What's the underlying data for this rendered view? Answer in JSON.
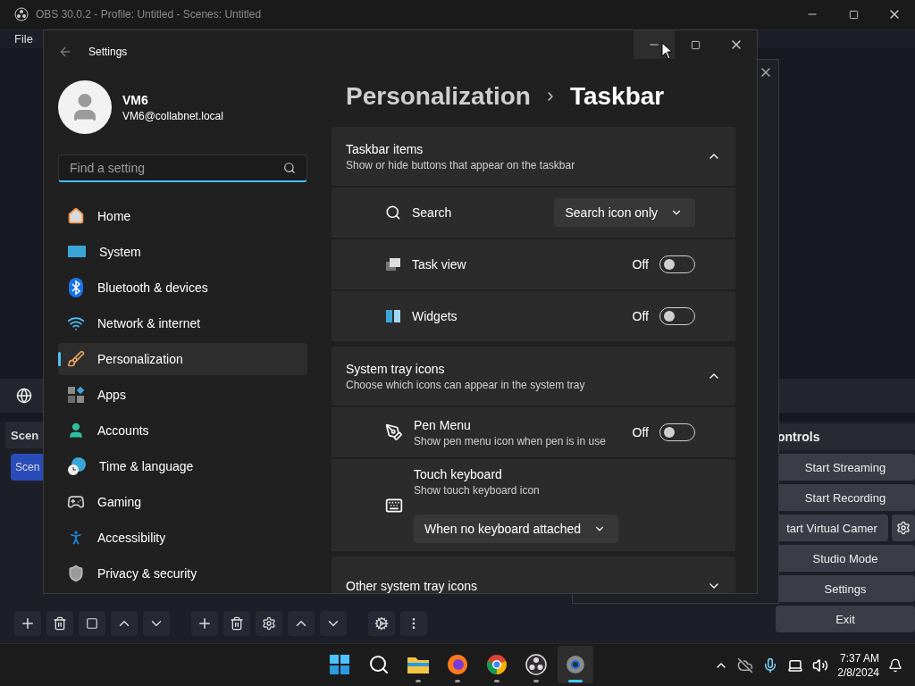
{
  "obs": {
    "title": "OBS 30.0.2 - Profile: Untitled - Scenes: Untitled",
    "menu": [
      "File"
    ],
    "scenes_dock": {
      "title": "Scen",
      "items": [
        {
          "label": "Scen",
          "selected": true
        }
      ]
    },
    "controls_dock": {
      "title": "ontrols",
      "buttons": [
        {
          "label": "Start Streaming",
          "kind": "plain"
        },
        {
          "label": "Start Recording",
          "kind": "plain"
        },
        {
          "label": "tart Virtual Camer",
          "kind": "split"
        },
        {
          "label": "Studio Mode",
          "kind": "plain"
        },
        {
          "label": "Settings",
          "kind": "plain"
        },
        {
          "label": "Exit",
          "kind": "plain"
        }
      ]
    }
  },
  "settings": {
    "title": "Settings",
    "user": {
      "name": "VM6",
      "email": "VM6@collabnet.local"
    },
    "search": {
      "placeholder": "Find a setting"
    },
    "nav": [
      {
        "label": "Home",
        "selected": false
      },
      {
        "label": "System",
        "selected": false
      },
      {
        "label": "Bluetooth & devices",
        "selected": false
      },
      {
        "label": "Network & internet",
        "selected": false
      },
      {
        "label": "Personalization",
        "selected": true
      },
      {
        "label": "Apps",
        "selected": false
      },
      {
        "label": "Accounts",
        "selected": false
      },
      {
        "label": "Time & language",
        "selected": false
      },
      {
        "label": "Gaming",
        "selected": false
      },
      {
        "label": "Accessibility",
        "selected": false
      },
      {
        "label": "Privacy & security",
        "selected": false
      }
    ],
    "breadcrumb": [
      "Personalization",
      "Taskbar"
    ],
    "sections": [
      {
        "title": "Taskbar items",
        "subtitle": "Show or hide buttons that appear on the taskbar",
        "expanded": true,
        "rows": [
          {
            "kind": "dropdown",
            "label": "Search",
            "value": "Search icon only"
          },
          {
            "kind": "toggle",
            "label": "Task view",
            "state": "Off",
            "on": false
          },
          {
            "kind": "toggle",
            "label": "Widgets",
            "state": "Off",
            "on": false
          }
        ]
      },
      {
        "title": "System tray icons",
        "subtitle": "Choose which icons can appear in the system tray",
        "expanded": true,
        "rows": [
          {
            "kind": "toggle",
            "label": "Pen Menu",
            "description": "Show pen menu icon when pen is in use",
            "state": "Off",
            "on": false
          },
          {
            "kind": "stacked_dropdown",
            "label": "Touch keyboard",
            "description": "Show touch keyboard icon",
            "value": "When no keyboard attached"
          }
        ]
      },
      {
        "title": "Other system tray icons",
        "expanded": false
      }
    ]
  },
  "taskbar": {
    "apps": [
      {
        "running": false,
        "selected": false
      },
      {
        "running": false,
        "selected": false
      },
      {
        "running": true,
        "selected": false
      },
      {
        "running": true,
        "selected": false
      },
      {
        "running": true,
        "selected": false
      },
      {
        "running": true,
        "selected": false
      },
      {
        "running": true,
        "selected": true
      }
    ],
    "time": "7:37 AM",
    "date": "2/8/2024"
  }
}
